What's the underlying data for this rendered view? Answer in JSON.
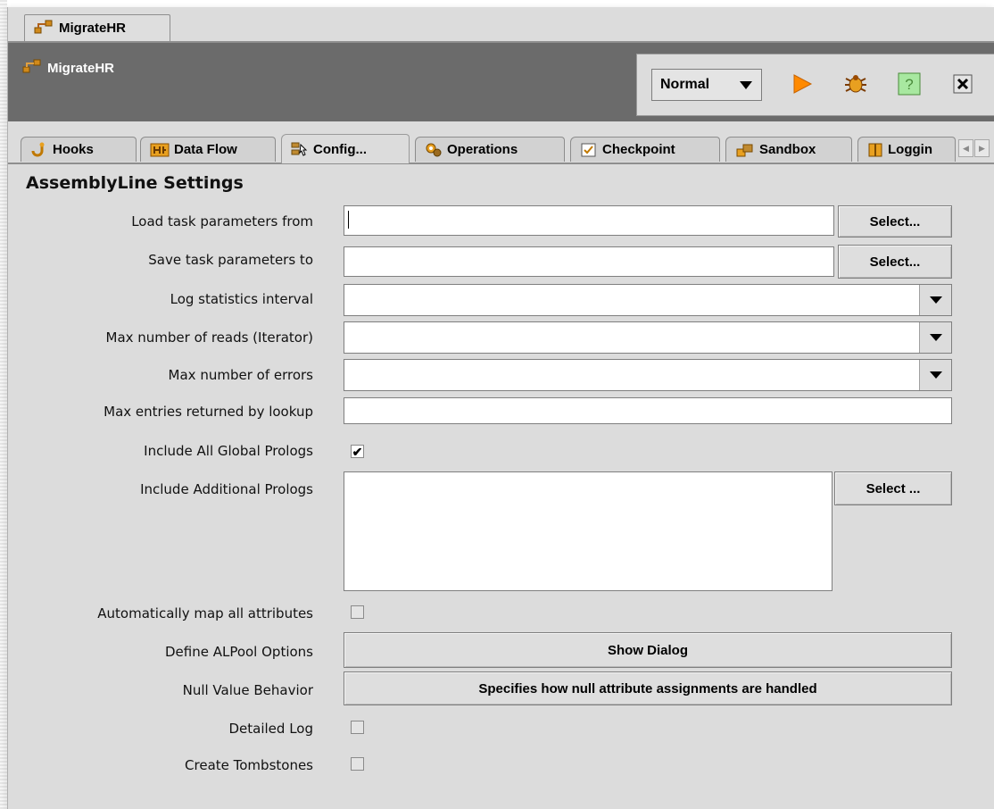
{
  "document_tab": {
    "label": "MigrateHR"
  },
  "header": {
    "title": "MigrateHR"
  },
  "toolbar": {
    "mode_value": "Normal",
    "run_icon": "play-icon",
    "debug_icon": "bug-icon",
    "help_icon": "help-icon",
    "close_icon": "close-icon"
  },
  "tabs": [
    {
      "label": "Hooks",
      "icon": "hook-icon",
      "active": false
    },
    {
      "label": "Data Flow",
      "icon": "data-flow-icon",
      "active": false
    },
    {
      "label": "Config...",
      "icon": "config-icon",
      "active": true
    },
    {
      "label": "Operations",
      "icon": "operations-icon",
      "active": false
    },
    {
      "label": "Checkpoint",
      "icon": "checkpoint-icon",
      "active": false
    },
    {
      "label": "Sandbox",
      "icon": "sandbox-icon",
      "active": false
    },
    {
      "label": "Loggin",
      "icon": "book-icon",
      "active": false
    }
  ],
  "settings": {
    "title": "AssemblyLine Settings",
    "load_params_label": "Load task parameters from",
    "load_params_value": "",
    "load_select_label": "Select...",
    "save_params_label": "Save task parameters to",
    "save_params_value": "",
    "save_select_label": "Select...",
    "log_interval_label": "Log statistics interval",
    "log_interval_value": "",
    "max_reads_label": "Max number of reads (Iterator)",
    "max_reads_value": "",
    "max_errors_label": "Max number of errors",
    "max_errors_value": "",
    "max_lookup_label": "Max entries returned by lookup",
    "max_lookup_value": "",
    "global_prologs_label": "Include All Global Prologs",
    "global_prologs_checked": true,
    "additional_prologs_label": "Include Additional Prologs",
    "additional_prologs_select_label": "Select ...",
    "automap_label": "Automatically map all attributes",
    "automap_checked": false,
    "alpool_label": "Define ALPool Options",
    "alpool_button": "Show Dialog",
    "null_value_label": "Null Value Behavior",
    "null_value_button": "Specifies how null attribute assignments are handled",
    "detailed_log_label": "Detailed Log",
    "detailed_log_checked": false,
    "tombstones_label": "Create Tombstones",
    "tombstones_checked": false
  },
  "colors": {
    "panel_bg": "#dcdcdc",
    "header_bg": "#6b6b6b",
    "play_orange": "#ff8a00"
  }
}
